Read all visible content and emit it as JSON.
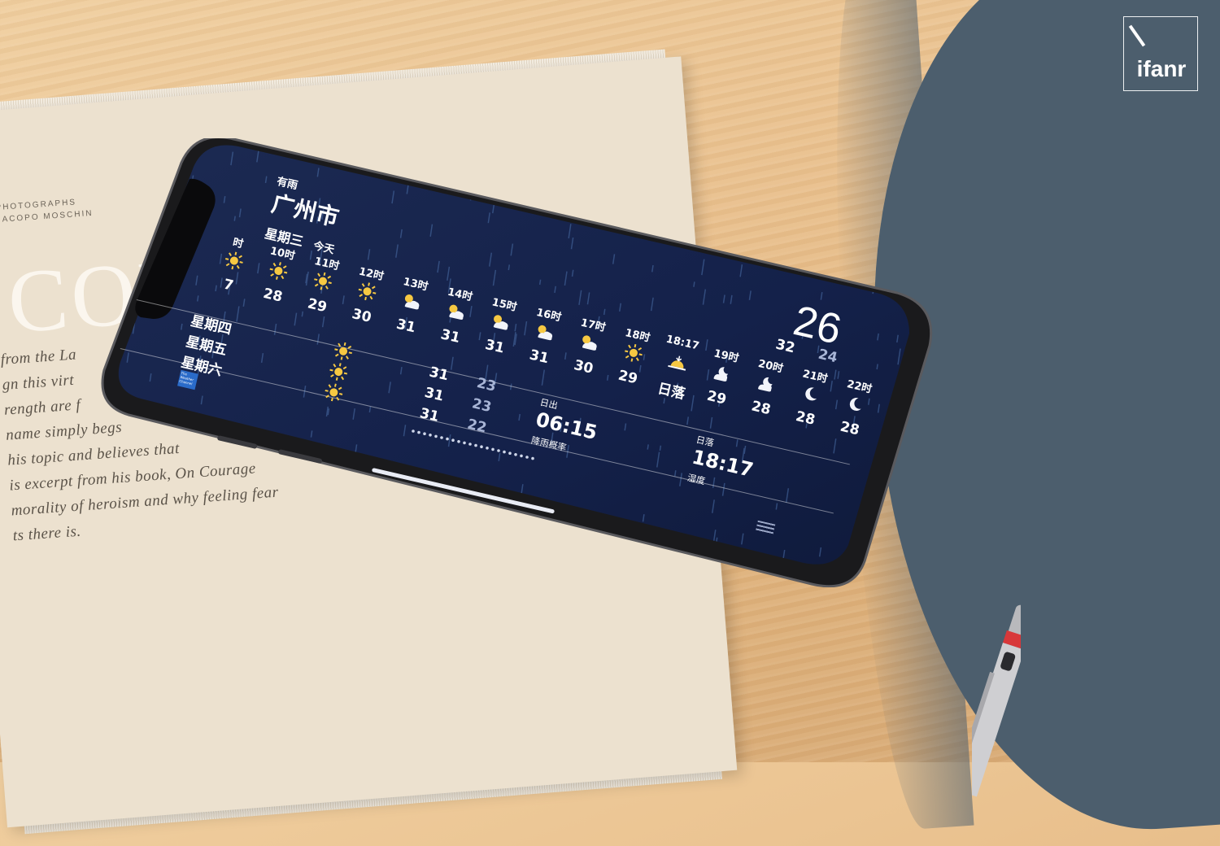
{
  "watermark": {
    "brand": "ifanr"
  },
  "book": {
    "credit_line1": "PHOTOGRAPHS",
    "credit_line2": "JACOPO MOSCHIN",
    "big_title": "COU",
    "text_lines": [
      "from the La",
      "gn this virt",
      "rength are f",
      " name simply begs",
      "his topic and believes that",
      "is excerpt from his book, On Courage",
      "morality of heroism and why feeling fear",
      "ts there is."
    ]
  },
  "weather": {
    "condition": "有雨",
    "city": "广州市",
    "weekday": "星期三",
    "today_label": "今天",
    "current_temp": "26",
    "today_high": "32",
    "today_low": "24",
    "hourly": [
      {
        "time": "时",
        "icon": "sun-icon",
        "temp": "7"
      },
      {
        "time": "10时",
        "icon": "sun-icon",
        "temp": "28"
      },
      {
        "time": "11时",
        "icon": "sun-icon",
        "temp": "29"
      },
      {
        "time": "12时",
        "icon": "sun-icon",
        "temp": "30"
      },
      {
        "time": "13时",
        "icon": "partly-cloudy-icon",
        "temp": "31"
      },
      {
        "time": "14时",
        "icon": "partly-cloudy-icon",
        "temp": "31"
      },
      {
        "time": "15时",
        "icon": "partly-cloudy-icon",
        "temp": "31"
      },
      {
        "time": "16时",
        "icon": "partly-cloudy-icon",
        "temp": "31"
      },
      {
        "time": "17时",
        "icon": "partly-cloudy-icon",
        "temp": "30"
      },
      {
        "time": "18时",
        "icon": "sun-icon",
        "temp": "29"
      },
      {
        "time": "18:17",
        "icon": "sunset-icon",
        "temp": "日落"
      },
      {
        "time": "19时",
        "icon": "cloud-night-icon",
        "temp": "29"
      },
      {
        "time": "20时",
        "icon": "cloud-night-icon",
        "temp": "28"
      },
      {
        "time": "21时",
        "icon": "moon-icon",
        "temp": "28"
      },
      {
        "time": "22时",
        "icon": "moon-icon",
        "temp": "28"
      }
    ],
    "daily": [
      {
        "day": "星期四",
        "icon": "sun-icon",
        "high": "31",
        "low": "23"
      },
      {
        "day": "星期五",
        "icon": "sun-icon",
        "high": "31",
        "low": "23"
      },
      {
        "day": "星期六",
        "icon": "sun-icon",
        "high": "31",
        "low": "22"
      }
    ],
    "sunrise_label": "日出",
    "sunrise_time": "06:15",
    "sunset_label": "日落",
    "sunset_time": "18:17",
    "rain_chance_label": "降雨概率",
    "humidity_label": "湿度",
    "attribution": "The Weather Channel"
  }
}
